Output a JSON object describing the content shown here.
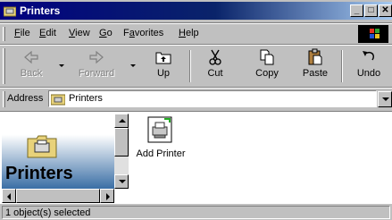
{
  "window": {
    "title": "Printers"
  },
  "menu": {
    "items": [
      {
        "pre": "",
        "u": "F",
        "post": "ile"
      },
      {
        "pre": "",
        "u": "E",
        "post": "dit"
      },
      {
        "pre": "",
        "u": "V",
        "post": "iew"
      },
      {
        "pre": "",
        "u": "G",
        "post": "o"
      },
      {
        "pre": "F",
        "u": "a",
        "post": "vorites"
      },
      {
        "pre": "",
        "u": "H",
        "post": "elp"
      }
    ]
  },
  "toolbar": {
    "back": "Back",
    "forward": "Forward",
    "up": "Up",
    "cut": "Cut",
    "copy": "Copy",
    "paste": "Paste",
    "undo": "Undo"
  },
  "address": {
    "label": "Address",
    "value": "Printers"
  },
  "panel": {
    "title": "Printers"
  },
  "items": [
    {
      "label": "Add Printer"
    }
  ],
  "status": {
    "text": "1 object(s) selected"
  },
  "colors": {
    "titlebar": "#000080",
    "face": "#c0c0c0",
    "banner": "#3a6ea5"
  }
}
